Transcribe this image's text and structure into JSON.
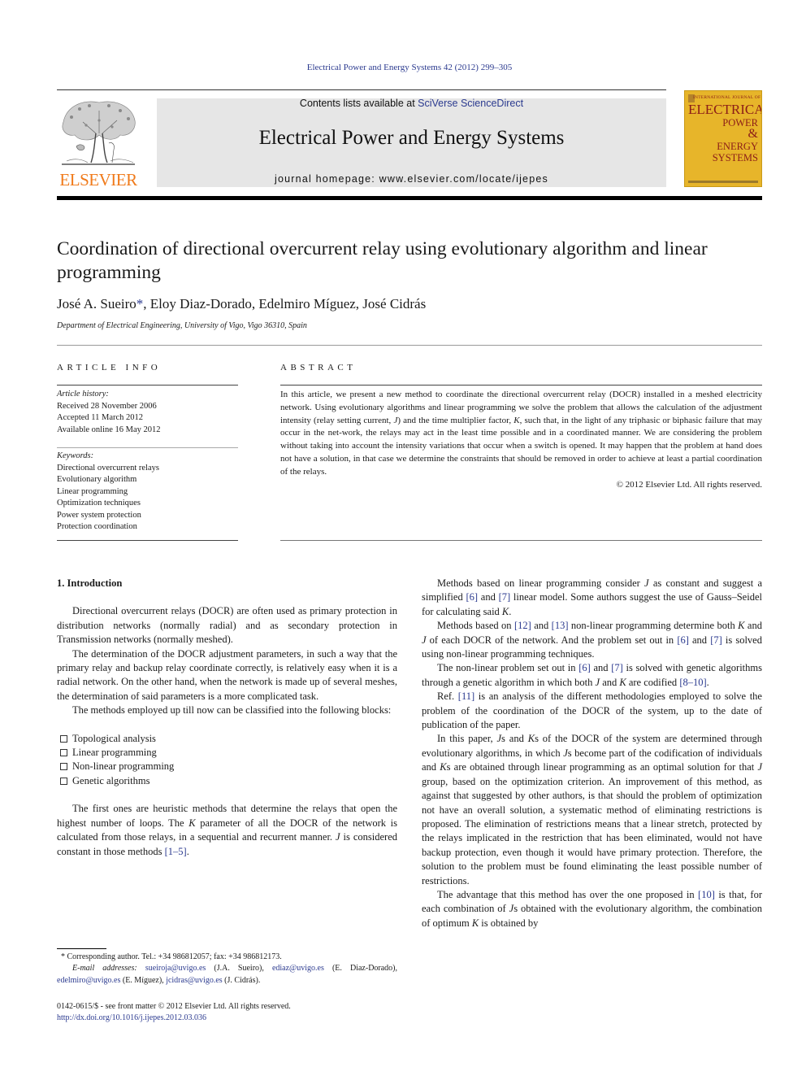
{
  "running_header": "Electrical Power and Energy Systems 42 (2012) 299–305",
  "masthead": {
    "publisher": "ELSEVIER",
    "contents_prefix": "Contents lists available at ",
    "contents_link": "SciVerse ScienceDirect",
    "journal_title": "Electrical Power and Energy Systems",
    "homepage": "journal homepage: www.elsevier.com/locate/ijepes",
    "cover": {
      "intl": "INTERNATIONAL JOURNAL OF",
      "line1": "ELECTRICAL",
      "line2": "POWER",
      "line3": "&",
      "line4": "ENERGY",
      "line5": "SYSTEMS"
    },
    "colors": {
      "publisher_orange": "#f07a1a",
      "cover_yellow": "#e7b52a",
      "cover_red": "#8c1d17",
      "link_blue": "#2b3a8f",
      "band_gray": "#e6e6e6"
    }
  },
  "article": {
    "title": "Coordination of directional overcurrent relay using evolutionary algorithm and linear programming",
    "authors": [
      {
        "name": "José A. Sueiro",
        "corresponding": "*"
      },
      {
        "name": "Eloy Diaz-Dorado"
      },
      {
        "name": "Edelmiro Míguez"
      },
      {
        "name": "José Cidrás"
      }
    ],
    "affiliation": "Department of Electrical Engineering, University of Vigo, Vigo 36310, Spain"
  },
  "article_info": {
    "heading": "ARTICLE INFO",
    "history_label": "Article history:",
    "history": [
      "Received 28 November 2006",
      "Accepted 11 March 2012",
      "Available online 16 May 2012"
    ],
    "keywords_label": "Keywords:",
    "keywords": [
      "Directional overcurrent relays",
      "Evolutionary algorithm",
      "Linear programming",
      "Optimization techniques",
      "Power system protection",
      "Protection coordination"
    ]
  },
  "abstract": {
    "heading": "ABSTRACT",
    "p1": "In this article, we present a new method to coordinate the directional overcurrent relay (DOCR) installed in a meshed electricity network. Using evolutionary algorithms and linear programming we solve the problem that allows the calculation of the adjustment intensity (relay setting current, ",
    "p1_J": "J",
    "p2": ") and the time multiplier factor, ",
    "p2_K": "K",
    "p3": ", such that, in the light of any triphasic or biphasic failure that may occur in the net-work, the relays may act in the least time possible and in a coordinated manner. We are considering the problem without taking into account the intensity variations that occur when a switch is opened. It may happen that the problem at hand does not have a solution, in that case we determine the constraints that should be removed in order to achieve at least a partial coordination of the relays.",
    "copyright": "© 2012 Elsevier Ltd. All rights reserved."
  },
  "body": {
    "section_heading": "1. Introduction",
    "col1": {
      "p1": "Directional overcurrent relays (DOCR) are often used as primary protection in distribution networks (normally radial) and as secondary protection in Transmission networks (normally meshed).",
      "p2": "The determination of the DOCR adjustment parameters, in such a way that the primary relay and backup relay coordinate correctly, is relatively easy when it is a radial network. On the other hand, when the network is made up of several meshes, the determination of said parameters is a more complicated task.",
      "p3": "The methods employed up till now can be classified into the following blocks:",
      "bullets": [
        "Topological analysis",
        "Linear programming",
        "Non-linear programming",
        "Genetic algorithms"
      ],
      "p4a": "The first ones are heuristic methods that determine the relays that open the highest number of loops. The ",
      "p4_K": "K",
      "p4b": " parameter of all the DOCR of the network is calculated from those relays, in a sequential and recurrent manner. ",
      "p4_J": "J",
      "p4c": " is considered constant in those methods ",
      "p4_ref": "[1–5]",
      "p4d": "."
    },
    "col2": {
      "p1a": "Methods based on linear programming consider ",
      "p1_J": "J",
      "p1b": " as constant and suggest a simplified ",
      "p1_ref6": "[6]",
      "p1c": " and ",
      "p1_ref7": "[7]",
      "p1d": " linear model. Some authors suggest the use of Gauss–Seidel for calculating said ",
      "p1_K": "K",
      "p1e": ".",
      "p2a": "Methods based on ",
      "p2_ref12": "[12]",
      "p2b": " and ",
      "p2_ref13": "[13]",
      "p2c": " non-linear programming determine both ",
      "p2_K": "K",
      "p2d": " and ",
      "p2_J": "J",
      "p2e": " of each DOCR of the network. And the problem set out in ",
      "p2_ref6": "[6]",
      "p2f": " and ",
      "p2_ref7": "[7]",
      "p2g": " is solved using non-linear programming techniques.",
      "p3a": "The non-linear problem set out in ",
      "p3_ref6": "[6]",
      "p3b": " and ",
      "p3_ref7": "[7]",
      "p3c": " is solved with genetic algorithms through a genetic algorithm in which both ",
      "p3_J": "J",
      "p3d": " and ",
      "p3_K": "K",
      "p3e": " are codified ",
      "p3_ref": "[8–10]",
      "p3f": ".",
      "p4a": "Ref. ",
      "p4_ref": "[11]",
      "p4b": " is an analysis of the different methodologies employed to solve the problem of the coordination of the DOCR of the system, up to the date of publication of the paper.",
      "p5a": "In this paper, ",
      "p5_Js": "J",
      "p5b": "s and ",
      "p5_Ks": "K",
      "p5c": "s of the DOCR of the system are determined through evolutionary algorithms, in which ",
      "p5_Js2": "J",
      "p5d": "s become part of the codification of individuals and ",
      "p5_Ks2": "K",
      "p5e": "s are obtained through linear programming as an optimal solution for that ",
      "p5_J": "J",
      "p5f": " group, based on the optimization criterion. An improvement of this method, as against that suggested by other authors, is that should the problem of optimization not have an overall solution, a systematic method of eliminating restrictions is proposed. The elimination of restrictions means that a linear stretch, protected by the relays implicated in the restriction that has been eliminated, would not have backup protection, even though it would have primary protection. Therefore, the solution to the problem must be found eliminating the least possible number of restrictions.",
      "p6a": "The advantage that this method has over the one proposed in ",
      "p6_ref": "[10]",
      "p6b": " is that, for each combination of ",
      "p6_Js": "J",
      "p6c": "s obtained with the evolutionary algorithm, the combination of optimum ",
      "p6_K": "K",
      "p6d": " is obtained by"
    }
  },
  "footnotes": {
    "star": "*",
    "corresponding": " Corresponding author. Tel.: +34 986812057; fax: +34 986812173.",
    "email_label": "E-mail addresses:",
    "emails": [
      {
        "addr": "sueiroja@uvigo.es",
        "who": " (J.A. Sueiro), "
      },
      {
        "addr": "ediaz@uvigo.es",
        "who": " (E. Diaz-Dorado), "
      },
      {
        "addr": "edelmiro@uvigo.es",
        "who": " (E. Míguez), "
      },
      {
        "addr": "jcidras@uvigo.es",
        "who": " (J. Cidrás)."
      }
    ],
    "issn": "0142-0615/$ - see front matter © 2012 Elsevier Ltd. All rights reserved.",
    "doi": "http://dx.doi.org/10.1016/j.ijepes.2012.03.036"
  }
}
